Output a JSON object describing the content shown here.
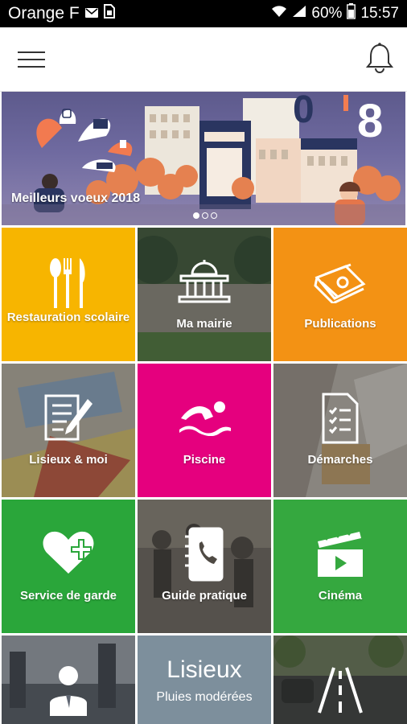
{
  "status_bar": {
    "carrier": "Orange F",
    "battery": "60%",
    "time": "15:57",
    "icons": [
      "mail-icon",
      "sim-icon",
      "wifi-icon",
      "signal-icon",
      "battery-icon"
    ]
  },
  "header": {
    "menu_icon": "hamburger-menu-icon",
    "notification_icon": "bell-icon"
  },
  "banner": {
    "caption": "Meilleurs voeux 2018",
    "year_fragment": "0'8",
    "slides": 3,
    "active_slide": 1
  },
  "tiles": [
    {
      "id": "restauration",
      "label": "Restauration scolaire",
      "color": "#f7b500",
      "icon": "cutlery-icon"
    },
    {
      "id": "mairie",
      "label": "Ma mairie",
      "color": "#4d6a45",
      "icon": "town-hall-icon"
    },
    {
      "id": "publications",
      "label": "Publications",
      "color": "#f39214",
      "icon": "newspaper-icon"
    },
    {
      "id": "lisieux-moi",
      "label": "Lisieux & moi",
      "color": "#6f6a66",
      "icon": "form-pen-icon"
    },
    {
      "id": "piscine",
      "label": "Piscine",
      "color": "#e5007e",
      "icon": "swimmer-icon"
    },
    {
      "id": "demarches",
      "label": "Démarches",
      "color": "#6c6864",
      "icon": "checklist-icon"
    },
    {
      "id": "garde",
      "label": "Service de garde",
      "color": "#2aa63a",
      "icon": "heart-plus-icon"
    },
    {
      "id": "guide",
      "label": "Guide pratique",
      "color": "#4f4a44",
      "icon": "phone-book-icon"
    },
    {
      "id": "cinema",
      "label": "Cinéma",
      "color": "#35a83f",
      "icon": "clapperboard-icon"
    },
    {
      "id": "profil",
      "label": "",
      "color": "#5d6470",
      "icon": "user-icon"
    },
    {
      "id": "meteo",
      "label": "",
      "color": "#7d8f9c",
      "icon": ""
    },
    {
      "id": "trafic",
      "label": "",
      "color": "#4b4e4c",
      "icon": "road-icon"
    }
  ],
  "weather": {
    "city": "Lisieux",
    "condition": "Pluies modérées"
  }
}
